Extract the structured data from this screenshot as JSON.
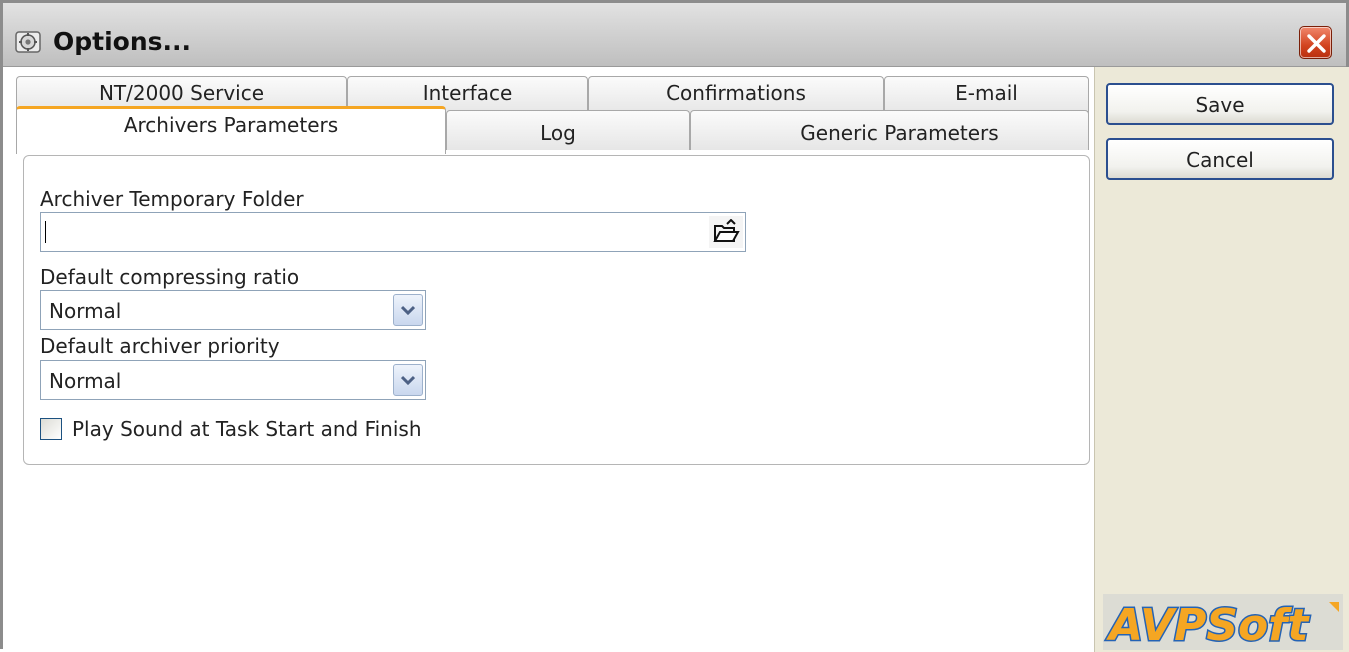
{
  "window": {
    "title": "Options...",
    "icon": "options-icon",
    "close_icon": "close-icon"
  },
  "tabs": {
    "back_row": [
      {
        "label": "NT/2000 Service"
      },
      {
        "label": "Interface"
      },
      {
        "label": "Confirmations"
      },
      {
        "label": "E-mail"
      }
    ],
    "front_row": [
      {
        "label": "Archivers Parameters",
        "selected": true
      },
      {
        "label": "Log"
      },
      {
        "label": "Generic Parameters"
      }
    ]
  },
  "archivers": {
    "temp_folder_label": "Archiver Temporary Folder",
    "temp_folder_value": "",
    "browse_icon": "folder-open-icon",
    "compress_label": "Default compressing ratio",
    "compress_value": "Normal",
    "priority_label": "Default archiver priority",
    "priority_value": "Normal",
    "dropdown_icon": "chevron-down-icon",
    "sound_label": "Play Sound at Task Start and Finish",
    "sound_checked": false
  },
  "actions": {
    "save_label": "Save",
    "cancel_label": "Cancel"
  },
  "branding": {
    "logo_text": "AVPSoft",
    "logo_color": "#f5a623",
    "logo_outline_color": "#2463b5"
  },
  "colors": {
    "accent_tab": "#f5a623",
    "button_border": "#2b4f8f",
    "sidebar_bg": "#ece9d8"
  }
}
